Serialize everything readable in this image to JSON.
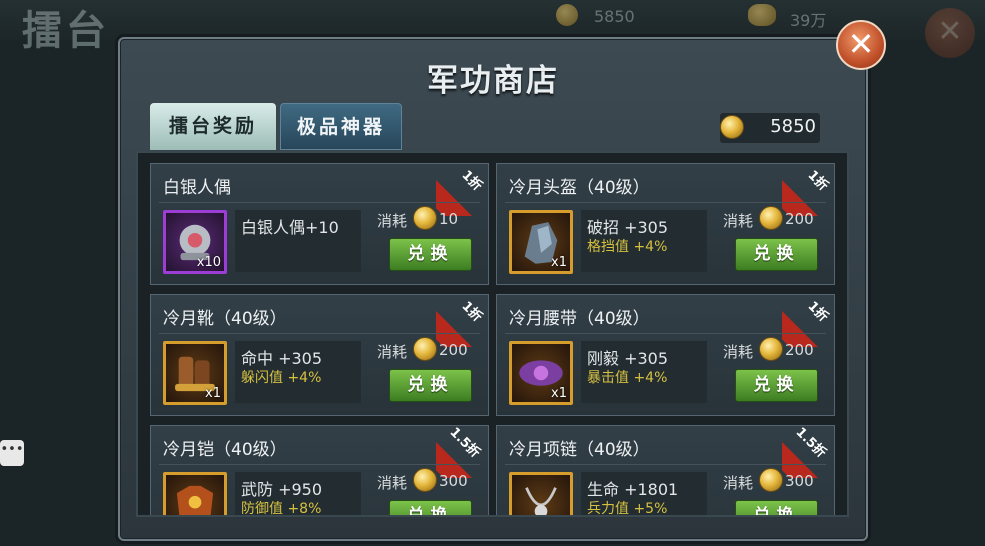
{
  "background": {
    "title": "擂台",
    "gold": "5850",
    "silver": "39万"
  },
  "dialog": {
    "title": "军功商店",
    "close_glyph": "✕",
    "tabs": [
      {
        "label": "擂台奖励",
        "active": true
      },
      {
        "label": "极品神器",
        "active": false
      }
    ],
    "balance": "5850",
    "cost_label": "消耗",
    "button_label": "兑换"
  },
  "items": [
    {
      "name": "白银人偶",
      "discount": "1折",
      "icon": "silver-doll-icon",
      "rarity": "purple",
      "qty": "x10",
      "stat1": "白银人偶+10",
      "stat2": "",
      "cost": "10"
    },
    {
      "name": "冷月头盔（40级）",
      "discount": "1折",
      "icon": "helmet-icon",
      "rarity": "gold",
      "qty": "x1",
      "stat1": "破招 +305",
      "stat2": "格挡值 +4%",
      "cost": "200"
    },
    {
      "name": "冷月靴（40级）",
      "discount": "1折",
      "icon": "boots-icon",
      "rarity": "gold",
      "qty": "x1",
      "stat1": "命中 +305",
      "stat2": "躲闪值 +4%",
      "cost": "200"
    },
    {
      "name": "冷月腰带（40级）",
      "discount": "1折",
      "icon": "belt-icon",
      "rarity": "gold",
      "qty": "x1",
      "stat1": "刚毅 +305",
      "stat2": "暴击值 +4%",
      "cost": "200"
    },
    {
      "name": "冷月铠（40级）",
      "discount": "1.5折",
      "icon": "armor-icon",
      "rarity": "gold",
      "qty": "x1",
      "stat1": "武防 +950",
      "stat2": "防御值 +8%",
      "cost": "300"
    },
    {
      "name": "冷月项链（40级）",
      "discount": "1.5折",
      "icon": "necklace-icon",
      "rarity": "gold",
      "qty": "x1",
      "stat1": "生命 +1801",
      "stat2": "兵力值 +5%",
      "cost": "300"
    }
  ]
}
